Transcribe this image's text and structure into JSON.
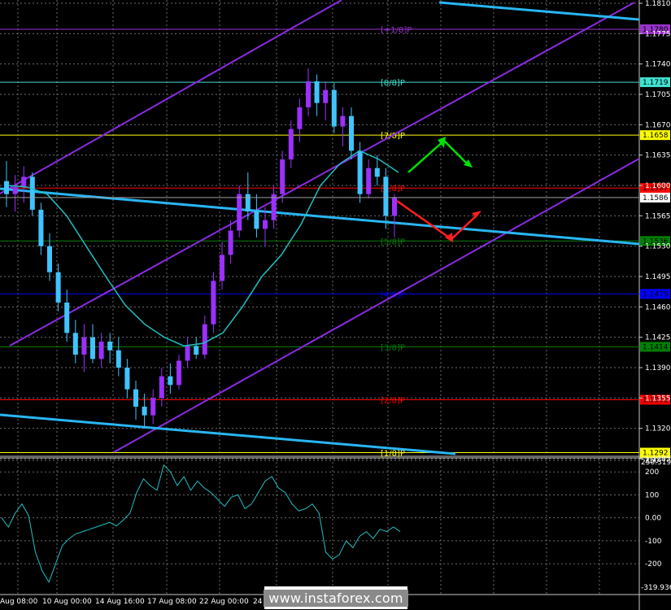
{
  "chart_data": [
    {
      "type": "candlestick",
      "title": "",
      "indicators": [
        "Moving average",
        "Murrey Math lines",
        "Regression channel"
      ],
      "price_axis": {
        "ylim": [
          1.1285,
          1.181
        ],
        "tick_labels": [
          "1.1810",
          "1.1775",
          "1.1740",
          "1.1705",
          "1.1670",
          "1.1635",
          "1.1600",
          "1.1565",
          "1.1530",
          "1.1495",
          "1.1460",
          "1.1425",
          "1.1390",
          "1.1355",
          "1.1320",
          "1.1285"
        ]
      },
      "time_axis": {
        "tick_labels": [
          "Aug 08:00",
          "10 Aug 00:00",
          "14 Aug 16:00",
          "17 Aug 08:00",
          "22 Aug 00:00",
          "24 Aug"
        ]
      },
      "current_price": "1.1586",
      "murrey_levels": [
        {
          "label": "[+1/8]P",
          "price": 1.178,
          "tag": "1.1780",
          "color": "#9932cc"
        },
        {
          "label": "[8/8]P",
          "price": 1.1719,
          "tag": "1.1719",
          "color": "#40e0d0"
        },
        {
          "label": "[7/8]P",
          "price": 1.1658,
          "tag": "1.1658",
          "color": "#ffff00"
        },
        {
          "label": "[6/8]P",
          "price": 1.1597,
          "tag": "1.1597",
          "color": "#ff0000"
        },
        {
          "label": "[5/8]P",
          "price": 1.1536,
          "tag": "1.1536",
          "color": "#008000"
        },
        {
          "label": "[4/8]P",
          "price": 1.1475,
          "tag": "1.1475",
          "color": "#0000ff"
        },
        {
          "label": "[3/8]P",
          "price": 1.1414,
          "tag": "1.1414",
          "color": "#008000"
        },
        {
          "label": "[2/8]P",
          "price": 1.1353,
          "tag": "1.1353",
          "color": "#ff0000"
        },
        {
          "label": "[1/8]P",
          "price": 1.1292,
          "tag": "1.1292",
          "color": "#ffff00"
        }
      ],
      "series": [
        {
          "type": "ohlc",
          "values": [
            [
              1.1605,
              1.1628,
              1.1575,
              1.159
            ],
            [
              1.159,
              1.1612,
              1.157,
              1.1598
            ],
            [
              1.1598,
              1.1622,
              1.158,
              1.161
            ],
            [
              1.161,
              1.1615,
              1.1565,
              1.1572
            ],
            [
              1.1572,
              1.158,
              1.152,
              1.153
            ],
            [
              1.153,
              1.1545,
              1.149,
              1.15
            ],
            [
              1.15,
              1.151,
              1.1455,
              1.1465
            ],
            [
              1.1465,
              1.148,
              1.142,
              1.143
            ],
            [
              1.143,
              1.1445,
              1.1395,
              1.1405
            ],
            [
              1.1405,
              1.144,
              1.1385,
              1.1425
            ],
            [
              1.1425,
              1.144,
              1.1395,
              1.14
            ],
            [
              1.14,
              1.143,
              1.139,
              1.142
            ],
            [
              1.142,
              1.143,
              1.1395,
              1.141
            ],
            [
              1.141,
              1.1425,
              1.138,
              1.139
            ],
            [
              1.139,
              1.14,
              1.1355,
              1.1365
            ],
            [
              1.1365,
              1.1375,
              1.133,
              1.1345
            ],
            [
              1.1345,
              1.136,
              1.132,
              1.1335
            ],
            [
              1.1335,
              1.1365,
              1.1325,
              1.1355
            ],
            [
              1.1355,
              1.139,
              1.1345,
              1.138
            ],
            [
              1.138,
              1.1395,
              1.136,
              1.137
            ],
            [
              1.137,
              1.1405,
              1.1365,
              1.1398
            ],
            [
              1.1398,
              1.1425,
              1.139,
              1.1415
            ],
            [
              1.1415,
              1.1425,
              1.14,
              1.1405
            ],
            [
              1.1405,
              1.145,
              1.14,
              1.144
            ],
            [
              1.144,
              1.15,
              1.143,
              1.149
            ],
            [
              1.149,
              1.1535,
              1.148,
              1.152
            ],
            [
              1.152,
              1.156,
              1.151,
              1.1548
            ],
            [
              1.1548,
              1.16,
              1.154,
              1.159
            ],
            [
              1.159,
              1.1615,
              1.156,
              1.157
            ],
            [
              1.157,
              1.159,
              1.154,
              1.155
            ],
            [
              1.155,
              1.1575,
              1.153,
              1.156
            ],
            [
              1.156,
              1.16,
              1.155,
              1.159
            ],
            [
              1.159,
              1.164,
              1.158,
              1.163
            ],
            [
              1.163,
              1.1675,
              1.162,
              1.1665
            ],
            [
              1.1665,
              1.17,
              1.165,
              1.169
            ],
            [
              1.169,
              1.1735,
              1.168,
              1.172
            ],
            [
              1.172,
              1.1728,
              1.168,
              1.1695
            ],
            [
              1.1695,
              1.172,
              1.1675,
              1.171
            ],
            [
              1.171,
              1.1718,
              1.166,
              1.1668
            ],
            [
              1.1668,
              1.169,
              1.1645,
              1.168
            ],
            [
              1.168,
              1.169,
              1.163,
              1.164
            ],
            [
              1.164,
              1.165,
              1.158,
              1.159
            ],
            [
              1.159,
              1.163,
              1.1585,
              1.162
            ],
            [
              1.162,
              1.1635,
              1.16,
              1.161
            ],
            [
              1.161,
              1.162,
              1.155,
              1.1565
            ],
            [
              1.1565,
              1.159,
              1.154,
              1.1586
            ]
          ]
        },
        {
          "type": "moving_average",
          "values": [
            1.16,
            1.1598,
            1.159,
            1.1565,
            1.153,
            1.1495,
            1.1462,
            1.144,
            1.1425,
            1.1415,
            1.1418,
            1.143,
            1.146,
            1.1495,
            1.152,
            1.1555,
            1.16,
            1.1625,
            1.164,
            1.163,
            1.1615
          ]
        }
      ],
      "forecast_arrows": [
        {
          "color": "#00e000",
          "direction": "up"
        },
        {
          "color": "#ff2020",
          "direction": "down"
        }
      ]
    },
    {
      "type": "line",
      "title": "",
      "ylim": [
        -319.936,
        250.3195
      ],
      "max_label": "250.3195",
      "min_label": "-319.936",
      "tick_labels": [
        "250",
        "200",
        "100",
        "0.00",
        "-100",
        "-200"
      ],
      "x": [
        0,
        1,
        2,
        3,
        4,
        5,
        6,
        7,
        8,
        9,
        10,
        11,
        12,
        13,
        14,
        15,
        16,
        17,
        18,
        19,
        20,
        21,
        22,
        23,
        24,
        25,
        26,
        27,
        28,
        29,
        30,
        31,
        32,
        33,
        34,
        35,
        36,
        37,
        38,
        39,
        40,
        41,
        42,
        43,
        44,
        45,
        46,
        47,
        48,
        49,
        50,
        51,
        52,
        53,
        54,
        55,
        56,
        57,
        58,
        59
      ],
      "series": [
        {
          "values": [
            0,
            -40,
            20,
            60,
            10,
            -150,
            -230,
            -280,
            -200,
            -120,
            -90,
            -70,
            -60,
            -50,
            -40,
            -30,
            -20,
            -35,
            -10,
            20,
            110,
            170,
            140,
            120,
            230,
            200,
            140,
            180,
            120,
            160,
            130,
            110,
            80,
            50,
            90,
            100,
            40,
            60,
            110,
            160,
            180,
            130,
            110,
            60,
            30,
            40,
            60,
            20,
            -150,
            -180,
            -160,
            -100,
            -130,
            -80,
            -60,
            -90,
            -50,
            -60,
            -40,
            -60
          ]
        }
      ]
    }
  ],
  "watermark": "www.instaforex.com"
}
